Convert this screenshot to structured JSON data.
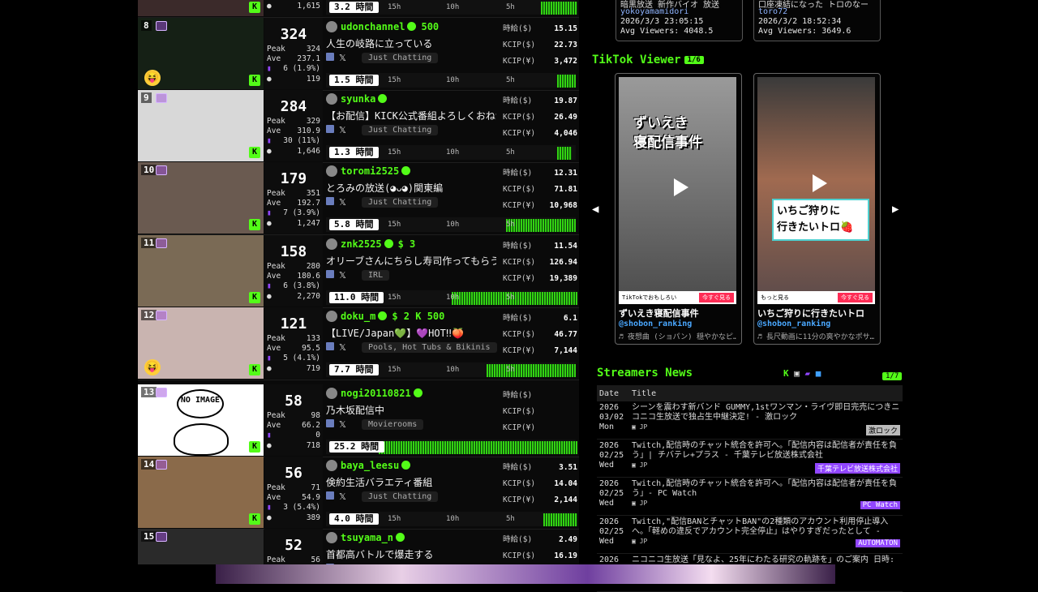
{
  "rows": [
    {
      "rank": "7",
      "peak_viewers": "",
      "peak": "",
      "ave": "",
      "wave": "",
      "viewers": "1,615",
      "name": "",
      "title": "",
      "tags": "",
      "category": "",
      "per_hour": "",
      "kcip_usd": "",
      "kcip_jpy": "",
      "duration": "3.2 時間",
      "t1": "15h",
      "t2": "10h",
      "t3": "5h"
    },
    {
      "rank": "8",
      "peak_viewers": "324",
      "peak": "324",
      "ave": "237.1",
      "wave": "6 (1.9%)",
      "viewers": "119",
      "name": "udonchannel",
      "extra": "500",
      "title": "人生の岐路に立っている",
      "category": "Just Chatting",
      "per_hour": "15.15",
      "kcip_usd": "22.73",
      "kcip_jpy": "3,472",
      "duration": "1.5 時間",
      "t1": "15h",
      "t2": "10h",
      "t3": "5h"
    },
    {
      "rank": "9",
      "peak_viewers": "284",
      "peak": "329",
      "ave": "310.9",
      "wave": "30 (11%)",
      "viewers": "1,646",
      "name": "syunka",
      "extra": "",
      "title": "【お配信】KICK公式番組よろしくおねがい",
      "category": "Just Chatting",
      "per_hour": "19.87",
      "kcip_usd": "26.49",
      "kcip_jpy": "4,046",
      "duration": "1.3 時間",
      "t1": "15h",
      "t2": "10h",
      "t3": "5h"
    },
    {
      "rank": "10",
      "peak_viewers": "179",
      "peak": "351",
      "ave": "192.7",
      "wave": "7 (3.9%)",
      "viewers": "1,247",
      "name": "toromi2525",
      "extra": "",
      "title": "とろみの放送(◕ᴗ◕)関東編",
      "category": "Just Chatting",
      "per_hour": "12.31",
      "kcip_usd": "71.81",
      "kcip_jpy": "10,968",
      "duration": "5.8 時間",
      "t1": "15h",
      "t2": "10h",
      "t3": "5h"
    },
    {
      "rank": "11",
      "peak_viewers": "158",
      "peak": "280",
      "ave": "180.6",
      "wave": "6 (3.8%)",
      "viewers": "2,270",
      "name": "znk2525",
      "extra": "$ 3",
      "title": "オリーブさんにちらし寿司作ってもらう←",
      "category": "IRL",
      "per_hour": "11.54",
      "kcip_usd": "126.94",
      "kcip_jpy": "19,389",
      "duration": "11.0 時間",
      "t1": "15h",
      "t2": "10h",
      "t3": "5h"
    },
    {
      "rank": "12",
      "peak_viewers": "121",
      "peak": "133",
      "ave": "95.5",
      "wave": "5 (4.1%)",
      "viewers": "719",
      "name": "doku_m",
      "extra": "$ 2  K 500",
      "title": "【LIVE/Japan💚】💜HOT‼🍑",
      "category": "Pools, Hot Tubs & Bikinis",
      "per_hour": "6.1",
      "kcip_usd": "46.77",
      "kcip_jpy": "7,144",
      "duration": "7.7 時間",
      "t1": "15h",
      "t2": "10h",
      "t3": "5h"
    },
    {
      "rank": "13",
      "peak_viewers": "58",
      "peak": "98",
      "ave": "66.2",
      "wave": "0",
      "viewers": "718",
      "name": "nogi20110821",
      "extra": "",
      "title": "乃木坂配信中",
      "category": "Movierooms",
      "per_hour": "",
      "kcip_usd": "",
      "kcip_jpy": "",
      "duration": "25.2 時間",
      "t1": "",
      "t2": "",
      "t3": "",
      "noimage": "NO IMAGE"
    },
    {
      "rank": "14",
      "peak_viewers": "56",
      "peak": "71",
      "ave": "54.9",
      "wave": "3 (5.4%)",
      "viewers": "389",
      "name": "baya_leesu",
      "extra": "",
      "title": "倹約生活バラエティ番組",
      "category": "Just Chatting",
      "per_hour": "3.51",
      "kcip_usd": "14.04",
      "kcip_jpy": "2,144",
      "duration": "4.0 時間",
      "t1": "15h",
      "t2": "10h",
      "t3": "5h"
    },
    {
      "rank": "15",
      "peak_viewers": "52",
      "peak": "56",
      "ave": "",
      "wave": "",
      "viewers": "",
      "name": "tsuyama_n",
      "extra": "",
      "title": "首都高バトルで爆走する",
      "category": "",
      "per_hour": "2.49",
      "kcip_usd": "16.19",
      "kcip_jpy": "",
      "duration": "",
      "t1": "",
      "t2": "",
      "t3": ""
    }
  ],
  "labels": {
    "peak": "Peak",
    "ave": "Ave",
    "per_hour": "時給($)",
    "kcip_usd": "KCIP($)",
    "kcip_jpy": "KCIP(¥)"
  },
  "top_cards": [
    {
      "title": "暗黒放送 新作バイオ 放送",
      "user": "yokoyamamidori",
      "date": "2026/3/3 23:05:15",
      "viewers": "Avg Viewers: 4048.5"
    },
    {
      "title": "口座凍結になった トロのなー",
      "user": "toro72",
      "date": "2026/3/2 18:52:34",
      "viewers": "Avg Viewers: 3649.6"
    }
  ],
  "tiktok": {
    "heading": "TikTok Viewer",
    "page": "1/6",
    "videos": [
      {
        "overlay": "ずいえき\n寝配信事件",
        "caption": "ずいえき寝配信事件",
        "handle": "@shobon_ranking",
        "sound": "♬ 夜想曲 (ショパン) 穏やかなピ…",
        "footer": "TikTokでおもしろい",
        "cta": "今すぐ見る"
      },
      {
        "overlay": "いちご狩りに\n行きたいトロ🍓",
        "caption": "いちご狩りに行きたいトロ",
        "handle": "@shobon_ranking",
        "sound": "♬ 長尺動画に11分の爽やかなポサ…",
        "footer": "もっと見る",
        "cta": "今すぐ見る"
      }
    ]
  },
  "news": {
    "heading": "Streamers News",
    "page": "1/7",
    "col_date": "Date",
    "col_title": "Title",
    "items": [
      {
        "date": "2026\n03/02\nMon",
        "title": "シーンを震わす新バンド GUMMY,1stワンマン・ライヴ即日完売につきニコニコ生放送で独占生中継決定! - 激ロック",
        "source": "激ロック",
        "src_color": "#bbbbbb"
      },
      {
        "date": "2026\n02/25\nWed",
        "title": "Twitch,配信時のチャット統合を許可へ。「配信内容は配信者が責任を負う」| チバテレ+プラス - 千葉テレビ放送株式会社",
        "source": "千葉テレビ放送株式会社",
        "src_color": "#9146ff"
      },
      {
        "date": "2026\n02/25\nWed",
        "title": "Twitch,配信時のチャット統合を許可へ。「配信内容は配信者が責任を負う」- PC Watch",
        "source": "PC Watch",
        "src_color": "#9146ff"
      },
      {
        "date": "2026\n02/25\nWed",
        "title": "Twitch,\"配信BANとチャットBAN\"の2種類のアカウント利用停止導入へ。「軽めの違反でアカウント完全停止」はやりすぎだったとして -",
        "source": "AUTOMATON",
        "src_color": "#9146ff"
      },
      {
        "date": "2026",
        "title": "ニコニコ生放送「見なよ、25年にわたる研究の軌跡を」のご案内 日時:",
        "source": "",
        "src_color": "#bbbbbb"
      }
    ]
  },
  "colors": {
    "accent": "#53fc18",
    "twitch": "#9146ff",
    "bg": "#000000"
  }
}
